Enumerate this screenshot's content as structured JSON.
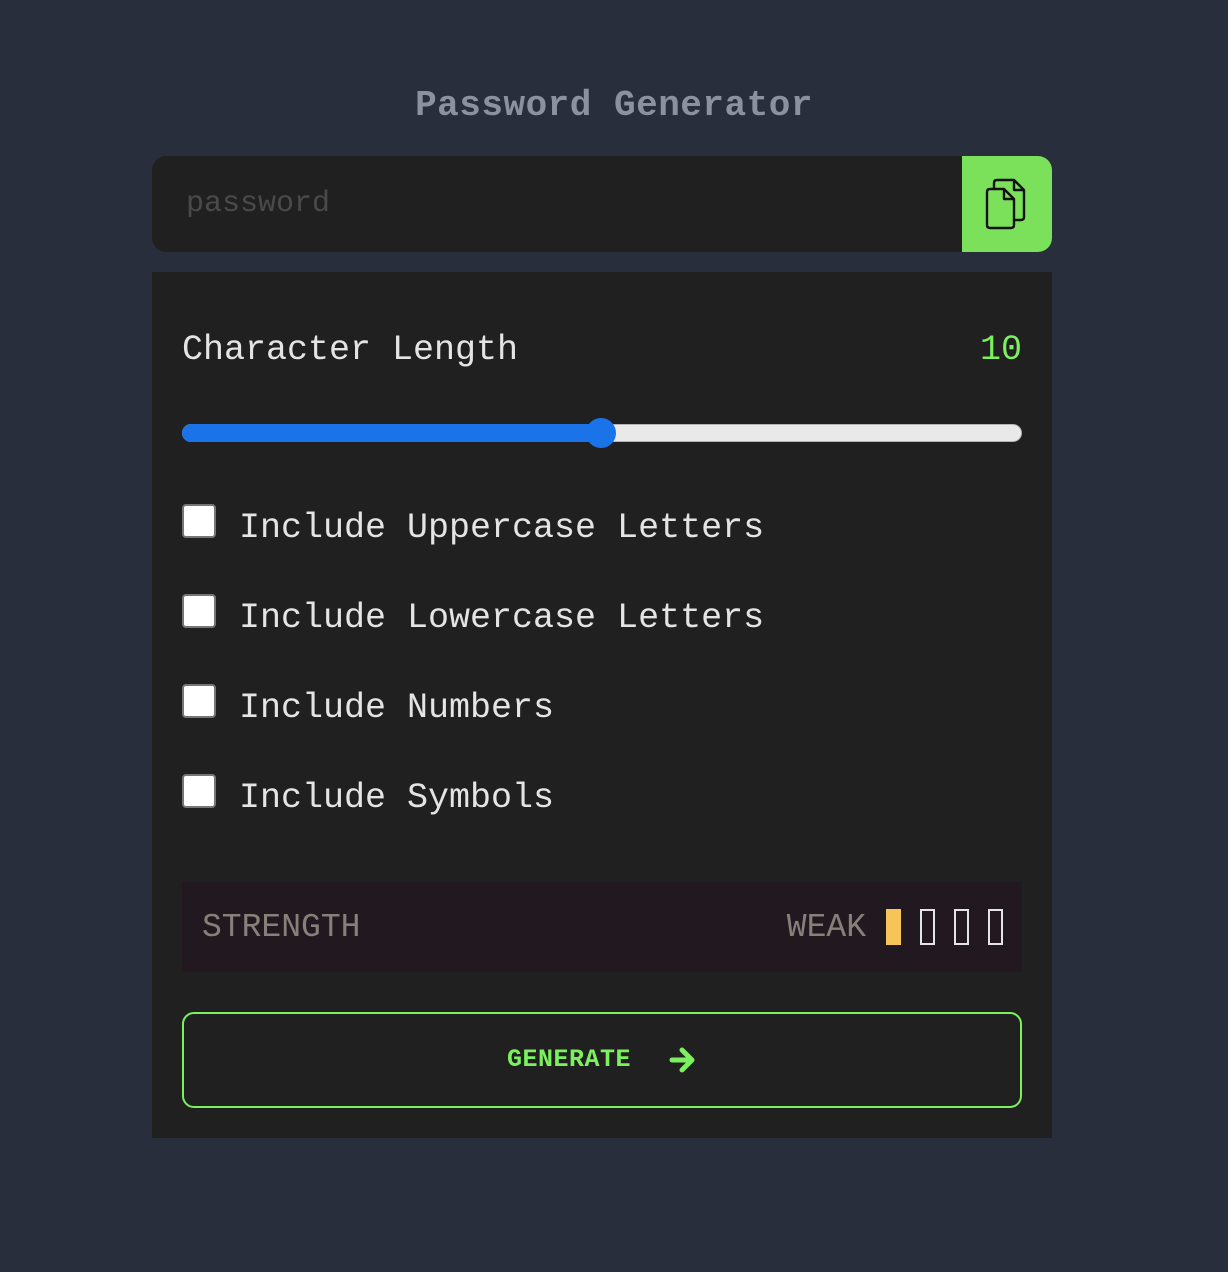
{
  "app": {
    "title": "Password Generator"
  },
  "password": {
    "value": "",
    "placeholder": "password",
    "copy_icon": "copy-icon",
    "copy_button_color": "#7be05a"
  },
  "length": {
    "label": "Character Length",
    "value": "10",
    "slider_fraction": 0.5,
    "slider_color": "#1a73e8"
  },
  "options": [
    {
      "label": "Include Uppercase Letters",
      "checked": false
    },
    {
      "label": "Include Lowercase Letters",
      "checked": false
    },
    {
      "label": "Include Numbers",
      "checked": false
    },
    {
      "label": "Include Symbols",
      "checked": false
    }
  ],
  "strength": {
    "label": "STRENGTH",
    "value": "WEAK",
    "level": 1,
    "total_levels": 4,
    "bar_color": "#f6c458"
  },
  "generate": {
    "label": "GENERATE",
    "icon": "arrow-right-icon",
    "color": "#7cf05e"
  }
}
